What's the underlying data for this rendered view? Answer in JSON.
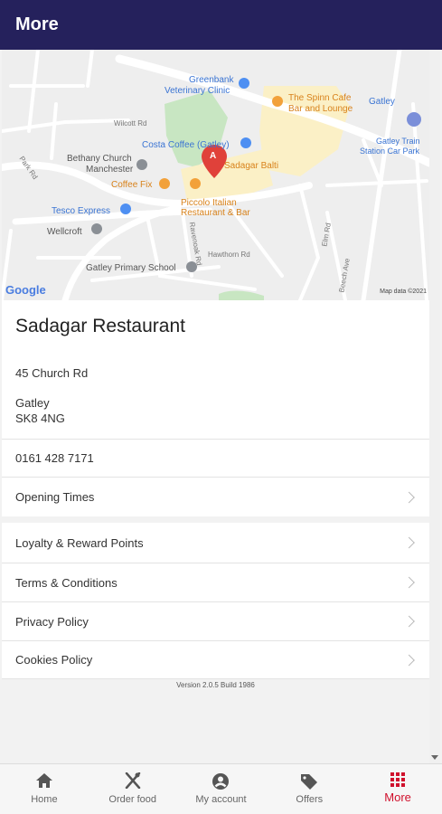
{
  "header": {
    "title": "More"
  },
  "map": {
    "attribution": "Map data ©2021",
    "logo": "Google",
    "pin_letter": "A",
    "labels": [
      "Greenbank",
      "Veterinary Clinic",
      "The Spinn Cafe",
      "Bar and Lounge",
      "Gatley",
      "Costa Coffee (Gatley)",
      "Sadagar Balti",
      "Bethany Church",
      "Manchester",
      "Coffee Fix",
      "Piccolo Italian",
      "Restaurant & Bar",
      "Tesco Express",
      "Wellcroft",
      "Gatley Primary School",
      "Gatley Train",
      "Station Car Park",
      "Park Rd",
      "Wilcott Rd",
      "Ravenoak Rd",
      "Hawthorn Rd",
      "Beech Ave",
      "Elm Rd"
    ]
  },
  "restaurant": {
    "name": "Sadagar Restaurant"
  },
  "address": {
    "line1": "45 Church Rd",
    "town": "Gatley",
    "postcode": "SK8 4NG"
  },
  "phone": "0161 428 7171",
  "menu": {
    "opening_times": "Opening Times",
    "loyalty": "Loyalty & Reward Points",
    "terms": "Terms & Conditions",
    "privacy": "Privacy Policy",
    "cookies": "Cookies Policy"
  },
  "version": "Version 2.0.5 Build 1986",
  "tabs": [
    {
      "label": "Home",
      "icon": "home-icon"
    },
    {
      "label": "Order food",
      "icon": "utensils-icon"
    },
    {
      "label": "My account",
      "icon": "account-icon"
    },
    {
      "label": "Offers",
      "icon": "tag-icon"
    },
    {
      "label": "More",
      "icon": "grid-icon"
    }
  ],
  "colors": {
    "header": "#25215c",
    "accent": "#d0102c"
  }
}
